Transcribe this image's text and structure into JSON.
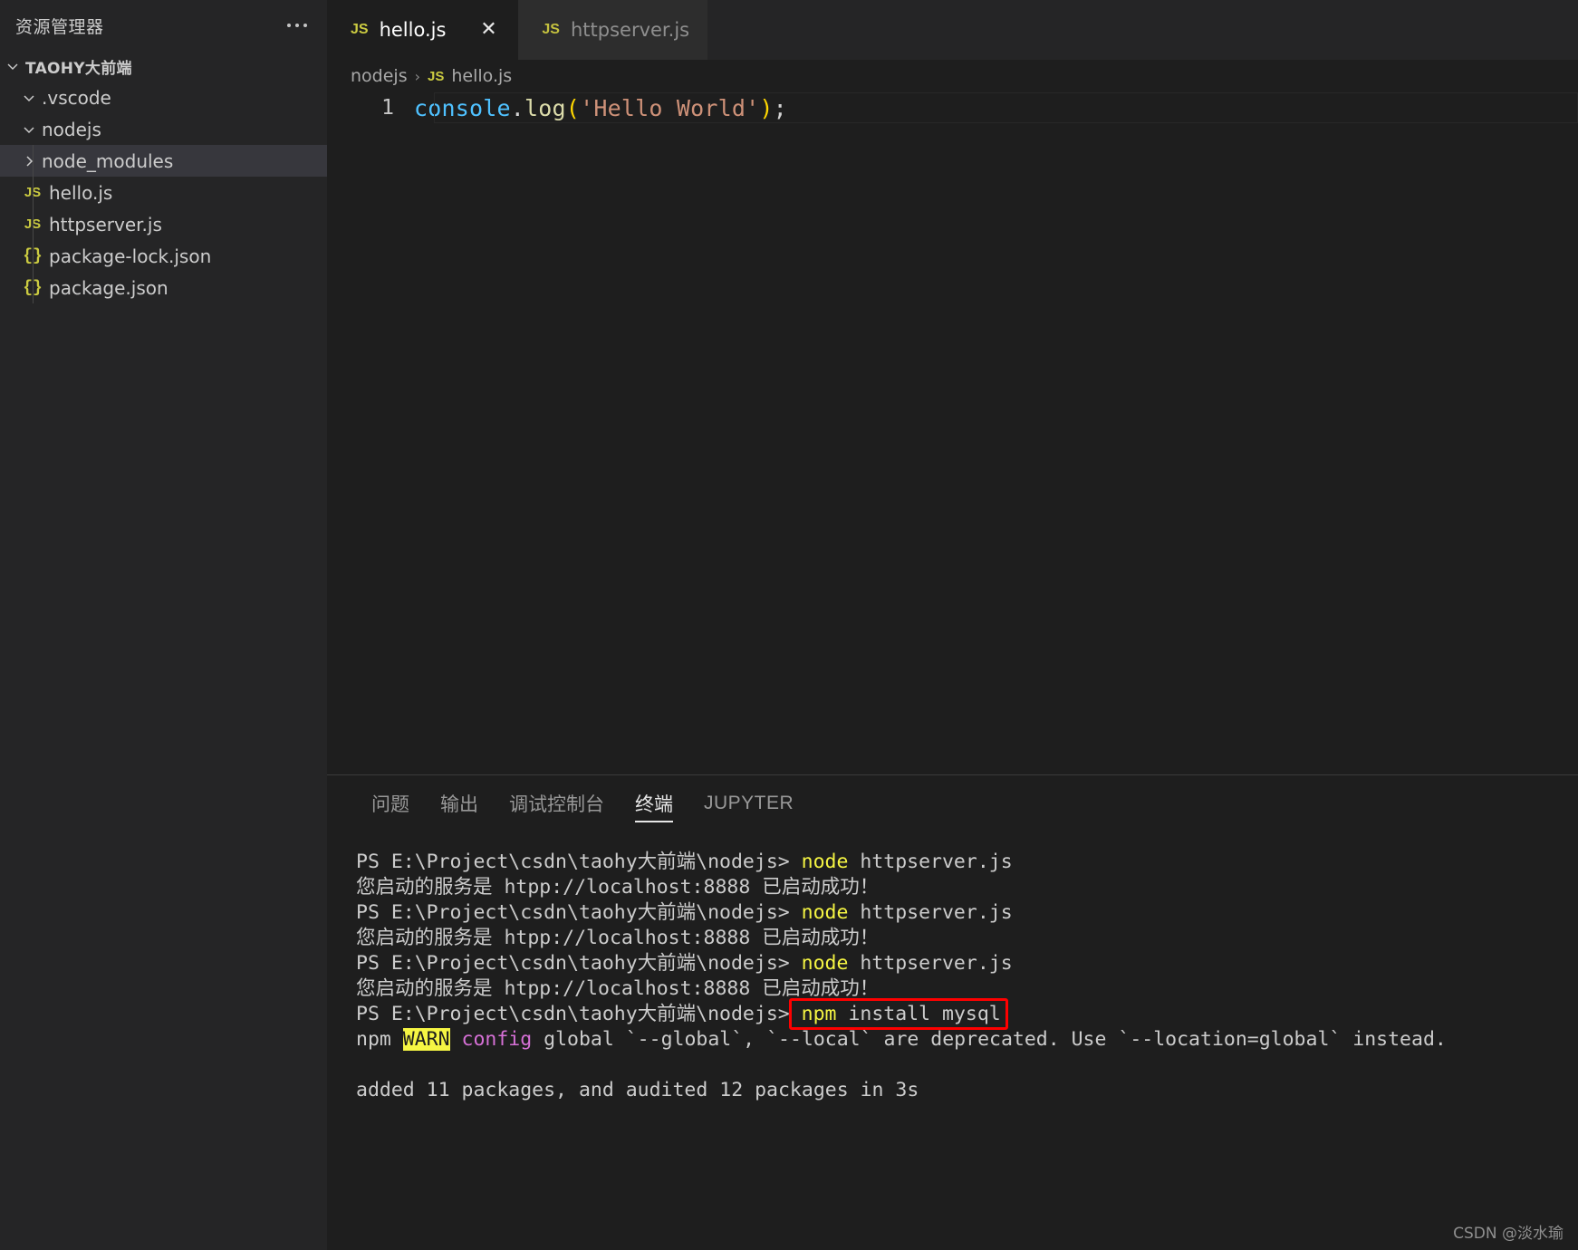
{
  "sidebar": {
    "title": "资源管理器",
    "more_icon": "ellipsis-icon",
    "root": {
      "label": "TAOHY大前端",
      "expanded": true
    },
    "items": [
      {
        "label": ".vscode",
        "kind": "folder",
        "expanded": true,
        "selected": false,
        "icon": "chevron-down-icon"
      },
      {
        "label": "nodejs",
        "kind": "folder",
        "expanded": true,
        "selected": false,
        "icon": "chevron-down-icon"
      },
      {
        "label": "node_modules",
        "kind": "folder",
        "expanded": false,
        "selected": true,
        "icon": "chevron-right-icon"
      },
      {
        "label": "hello.js",
        "kind": "js",
        "badge": "JS",
        "selected": false,
        "icon": "js-file-icon"
      },
      {
        "label": "httpserver.js",
        "kind": "js",
        "badge": "JS",
        "selected": false,
        "icon": "js-file-icon"
      },
      {
        "label": "package-lock.json",
        "kind": "json",
        "badge": "{}",
        "selected": false,
        "icon": "json-file-icon"
      },
      {
        "label": "package.json",
        "kind": "json",
        "badge": "{}",
        "selected": false,
        "icon": "json-file-icon"
      }
    ]
  },
  "tabs": [
    {
      "label": "hello.js",
      "badge": "JS",
      "active": true,
      "close_icon": "close-icon",
      "close_glyph": "✕"
    },
    {
      "label": "httpserver.js",
      "badge": "JS",
      "active": false
    }
  ],
  "breadcrumb": {
    "folder": "nodejs",
    "separator": "›",
    "badge": "JS",
    "file": "hello.js"
  },
  "editor": {
    "line_number": "1",
    "tokens": [
      {
        "text": "console",
        "color": "#4fc1ff"
      },
      {
        "text": ".",
        "color": "#d4d4d4"
      },
      {
        "text": "log",
        "color": "#dcdcaa"
      },
      {
        "text": "(",
        "color": "#ffd700"
      },
      {
        "text": "'Hello World'",
        "color": "#ce9178"
      },
      {
        "text": ")",
        "color": "#ffd700"
      },
      {
        "text": ";",
        "color": "#d4d4d4"
      }
    ],
    "plain_text": "console.log('Hello World');"
  },
  "panel": {
    "tabs": [
      {
        "label": "问题",
        "active": false,
        "latin": false
      },
      {
        "label": "输出",
        "active": false,
        "latin": false
      },
      {
        "label": "调试控制台",
        "active": false,
        "latin": false
      },
      {
        "label": "终端",
        "active": true,
        "latin": false
      },
      {
        "label": "JUPYTER",
        "active": false,
        "latin": true
      }
    ]
  },
  "terminal": {
    "prompt": "PS E:\\Project\\csdn\\taohy大前端\\nodejs> ",
    "lines": [
      {
        "segments": [
          {
            "t": "PS E:\\Project\\csdn\\taohy大前端\\nodejs> ",
            "c": "white"
          },
          {
            "t": "node",
            "c": "yellow"
          },
          {
            "t": " httpserver.js",
            "c": "white"
          }
        ]
      },
      {
        "segments": [
          {
            "t": "您启动的服务是 htpp://localhost:8888 已启动成功！",
            "c": "white"
          }
        ]
      },
      {
        "segments": [
          {
            "t": "PS E:\\Project\\csdn\\taohy大前端\\nodejs> ",
            "c": "white"
          },
          {
            "t": "node",
            "c": "yellow"
          },
          {
            "t": " httpserver.js",
            "c": "white"
          }
        ]
      },
      {
        "segments": [
          {
            "t": "您启动的服务是 htpp://localhost:8888 已启动成功！",
            "c": "white"
          }
        ]
      },
      {
        "segments": [
          {
            "t": "PS E:\\Project\\csdn\\taohy大前端\\nodejs> ",
            "c": "white"
          },
          {
            "t": "node",
            "c": "yellow"
          },
          {
            "t": " httpserver.js",
            "c": "white"
          }
        ]
      },
      {
        "segments": [
          {
            "t": "您启动的服务是 htpp://localhost:8888 已启动成功！",
            "c": "white"
          }
        ]
      },
      {
        "segments": [
          {
            "t": "PS E:\\Project\\csdn\\taohy大前端\\nodejs> ",
            "c": "white"
          },
          {
            "t": "npm",
            "c": "yellow"
          },
          {
            "t": " install mysql",
            "c": "white"
          }
        ]
      },
      {
        "segments": [
          {
            "t": "npm ",
            "c": "white"
          },
          {
            "t": "WARN",
            "c": "warnhl"
          },
          {
            "t": " ",
            "c": "white"
          },
          {
            "t": "config",
            "c": "magenta"
          },
          {
            "t": " global `--global`, `--local` are deprecated. Use `--location=global` instead.",
            "c": "white"
          }
        ]
      },
      {
        "segments": [
          {
            "t": "",
            "c": "white"
          }
        ]
      },
      {
        "segments": [
          {
            "t": "added 11 packages, and audited 12 packages in 3s",
            "c": "white"
          }
        ]
      }
    ],
    "highlight_box": {
      "label": "npm install mysql",
      "color": "#ff0000"
    }
  },
  "watermark": {
    "text": "CSDN @淡水瑜"
  }
}
